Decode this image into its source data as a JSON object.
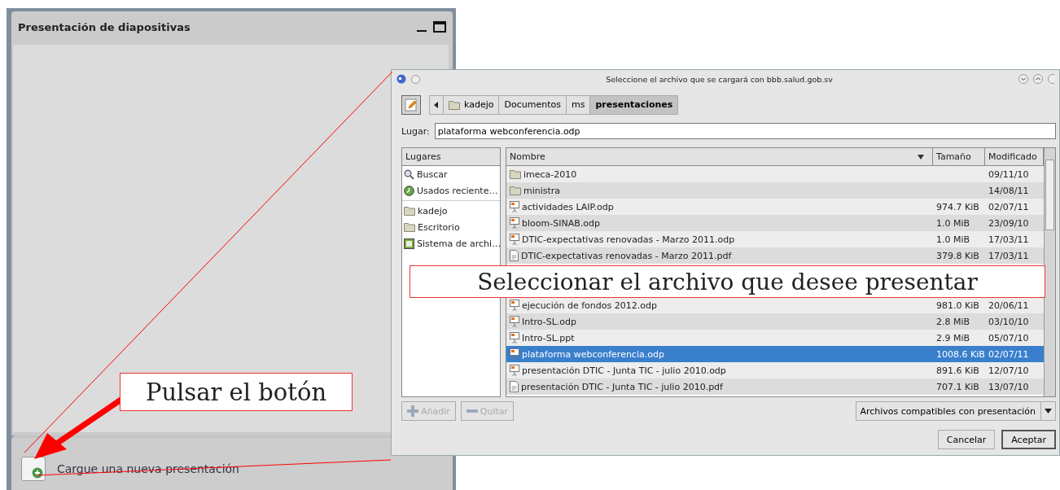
{
  "panel": {
    "title": "Presentación de diapositivas",
    "upload_label": "Cargue una nueva presentación"
  },
  "dialog": {
    "title": "Seleccione el archivo que se cargará con bbb.salud.gob.sv",
    "path": [
      {
        "label": "kadejo",
        "kind": "folder",
        "selected": false
      },
      {
        "label": "Documentos",
        "kind": "plain",
        "selected": false
      },
      {
        "label": "ms",
        "kind": "plain",
        "selected": false
      },
      {
        "label": "presentaciones",
        "kind": "plain",
        "selected": true
      }
    ],
    "location_label": "Lugar:",
    "location_value": "plataforma webconferencia.odp",
    "places_header": "Lugares",
    "places_groups": [
      [
        {
          "label": "Buscar",
          "kind": "search"
        },
        {
          "label": "Usados reciente…",
          "kind": "recent"
        }
      ],
      [
        {
          "label": "kadejo",
          "kind": "folder"
        },
        {
          "label": "Escritorio",
          "kind": "folder"
        },
        {
          "label": "Sistema de archi…",
          "kind": "drive"
        }
      ]
    ],
    "columns": [
      {
        "label": "Nombre",
        "sorted": true
      },
      {
        "label": "Tamaño",
        "sorted": false
      },
      {
        "label": "Modificado",
        "sorted": false
      }
    ],
    "rows_above_callout": [
      {
        "name": "imeca-2010",
        "modified": "09/11/10",
        "kind": "folder",
        "selected": false
      },
      {
        "name": "ministra",
        "modified": "14/08/11",
        "kind": "folder",
        "selected": false
      },
      {
        "name": "actividades LAIP.odp",
        "size": "974.7 KiB",
        "modified": "02/07/11",
        "kind": "presentation",
        "selected": false
      },
      {
        "name": "bloom-SINAB.odp",
        "size": "1.0 MiB",
        "modified": "23/09/10",
        "kind": "presentation",
        "selected": false
      },
      {
        "name": "DTIC-expectativas renovadas - Marzo 2011.odp",
        "size": "1.0 MiB",
        "modified": "17/03/11",
        "kind": "presentation",
        "selected": false
      },
      {
        "name": "DTIC-expectativas renovadas - Marzo 2011.pdf",
        "size": "379.8 KiB",
        "modified": "17/03/11",
        "kind": "document",
        "selected": false
      }
    ],
    "rows_below_callout": [
      {
        "name": "ejecución de fondos 2012.odp",
        "size": "981.0 KiB",
        "modified": "20/06/11",
        "kind": "presentation",
        "selected": false
      },
      {
        "name": "Intro-SL.odp",
        "size": "2.8 MiB",
        "modified": "03/10/10",
        "kind": "presentation",
        "selected": false
      },
      {
        "name": "Intro-SL.ppt",
        "size": "2.9 MiB",
        "modified": "05/07/10",
        "kind": "presentation",
        "selected": false
      },
      {
        "name": "plataforma webconferencia.odp",
        "size": "1008.6 KiB",
        "modified": "02/07/11",
        "kind": "presentation",
        "selected": true
      },
      {
        "name": "presentación DTIC - Junta TIC - julio 2010.odp",
        "size": "891.6 KiB",
        "modified": "12/07/10",
        "kind": "presentation",
        "selected": false
      },
      {
        "name": "presentación DTIC - Junta TIC - julio 2010.pdf",
        "size": "707.1 KiB",
        "modified": "13/07/10",
        "kind": "document",
        "selected": false
      }
    ],
    "add_button": {
      "label": "Añadir",
      "disabled": true
    },
    "remove_button": {
      "label": "Quitar",
      "disabled": true
    },
    "filter": "Archivos compatibles con presentación",
    "cancel_button": "Cancelar",
    "accept_button": "Aceptar"
  },
  "callouts": [
    {
      "text": "Seleccionar el archivo que desee presentar"
    },
    {
      "text": "Pulsar el botón"
    }
  ]
}
